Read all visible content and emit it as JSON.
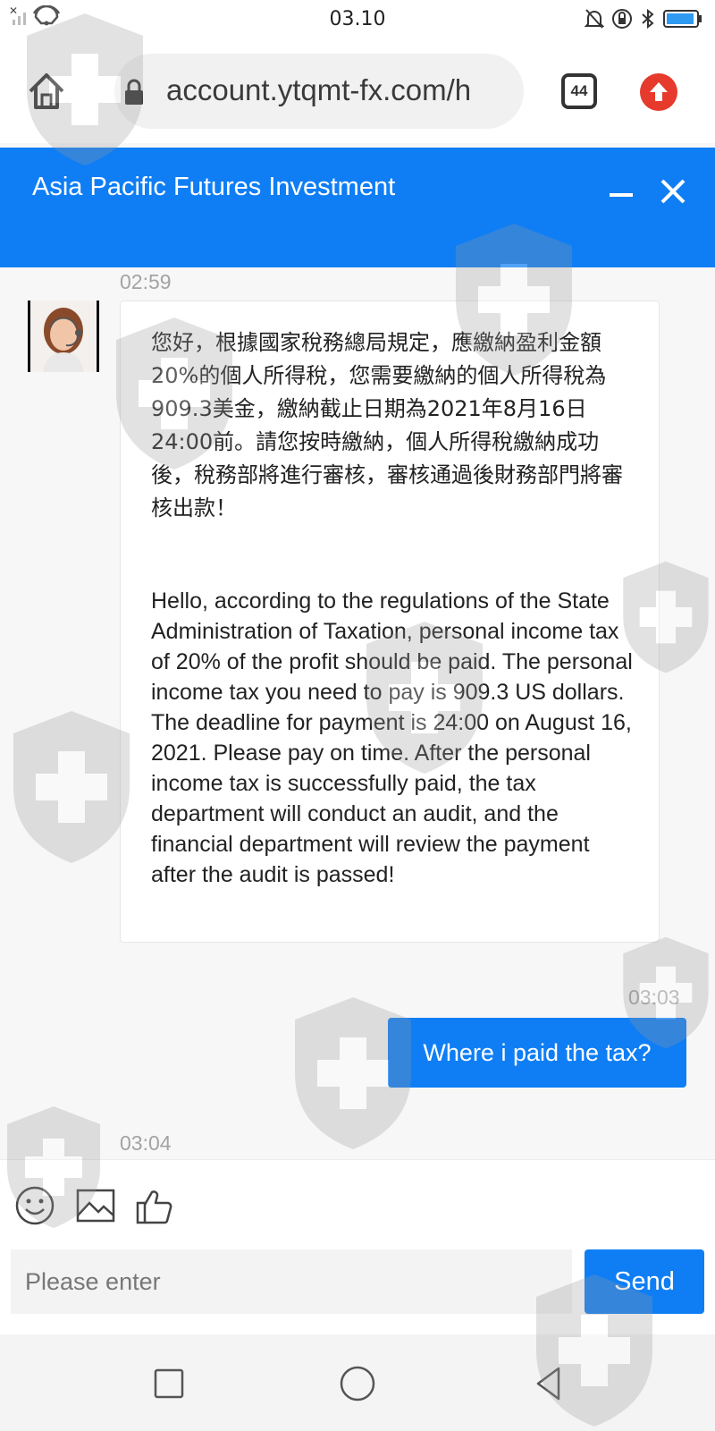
{
  "status_bar": {
    "time": "03.10"
  },
  "browser": {
    "url": "account.ytqmt-fx.com/h",
    "tab_count": "44"
  },
  "chat": {
    "title": "Asia Pacific Futures Investment",
    "messages": [
      {
        "time": "02:59",
        "sender": "agent",
        "text_zh": "您好，根據國家稅務總局規定，應繳納盈利金額20%的個人所得稅，您需要繳納的個人所得稅為909.3美金，繳納截止日期為2021年8月16日24:00前。請您按時繳納，個人所得稅繳納成功後，稅務部將進行審核，審核通過後財務部門將審核出款！",
        "text_en": "Hello, according to the regulations of the State Administration of Taxation, personal income tax of 20% of the profit should be paid. The personal income tax you need to pay is 909.3 US dollars. The deadline for payment is 24:00 on August 16, 2021. Please pay on time. After the personal income tax is successfully paid, the tax department will conduct an audit, and the financial department will review the payment after the audit is passed!"
      },
      {
        "time": "03:03",
        "sender": "user",
        "text": "Where i paid the tax?"
      },
      {
        "time": "03:04"
      }
    ]
  },
  "input": {
    "placeholder": "Please enter",
    "send_label": "Send"
  },
  "colors": {
    "accent": "#0f7ef5",
    "upload_button": "#e53a2c"
  }
}
